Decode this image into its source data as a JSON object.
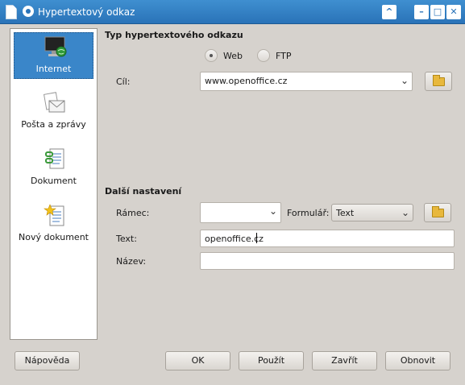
{
  "window": {
    "title": "Hypertextový odkaz",
    "buttons": {
      "up": "^",
      "minimize": "–",
      "maximize": "□",
      "close": "✕"
    }
  },
  "sidebar": {
    "items": [
      {
        "label": "Internet",
        "icon": "internet-icon"
      },
      {
        "label": "Pošta a zprávy",
        "icon": "mail-icon"
      },
      {
        "label": "Dokument",
        "icon": "document-icon"
      },
      {
        "label": "Nový dokument",
        "icon": "new-document-icon"
      }
    ],
    "selected": "Internet"
  },
  "hyperlink_type": {
    "title": "Typ hypertextového odkazu",
    "options": [
      {
        "label": "Web",
        "checked": true
      },
      {
        "label": "FTP",
        "checked": false
      }
    ],
    "target_label": "Cíl:",
    "target_value": "www.openoffice.cz"
  },
  "further_settings": {
    "title": "Další nastavení",
    "frame_label": "Rámec:",
    "frame_value": "",
    "form_label": "Formulář:",
    "form_value": "Text",
    "text_label": "Text:",
    "text_value": "openoffice.cz",
    "name_label": "Název:",
    "name_value": ""
  },
  "footer": {
    "help": "Nápověda",
    "ok": "OK",
    "apply": "Použít",
    "close": "Zavřít",
    "reset": "Obnovit"
  }
}
